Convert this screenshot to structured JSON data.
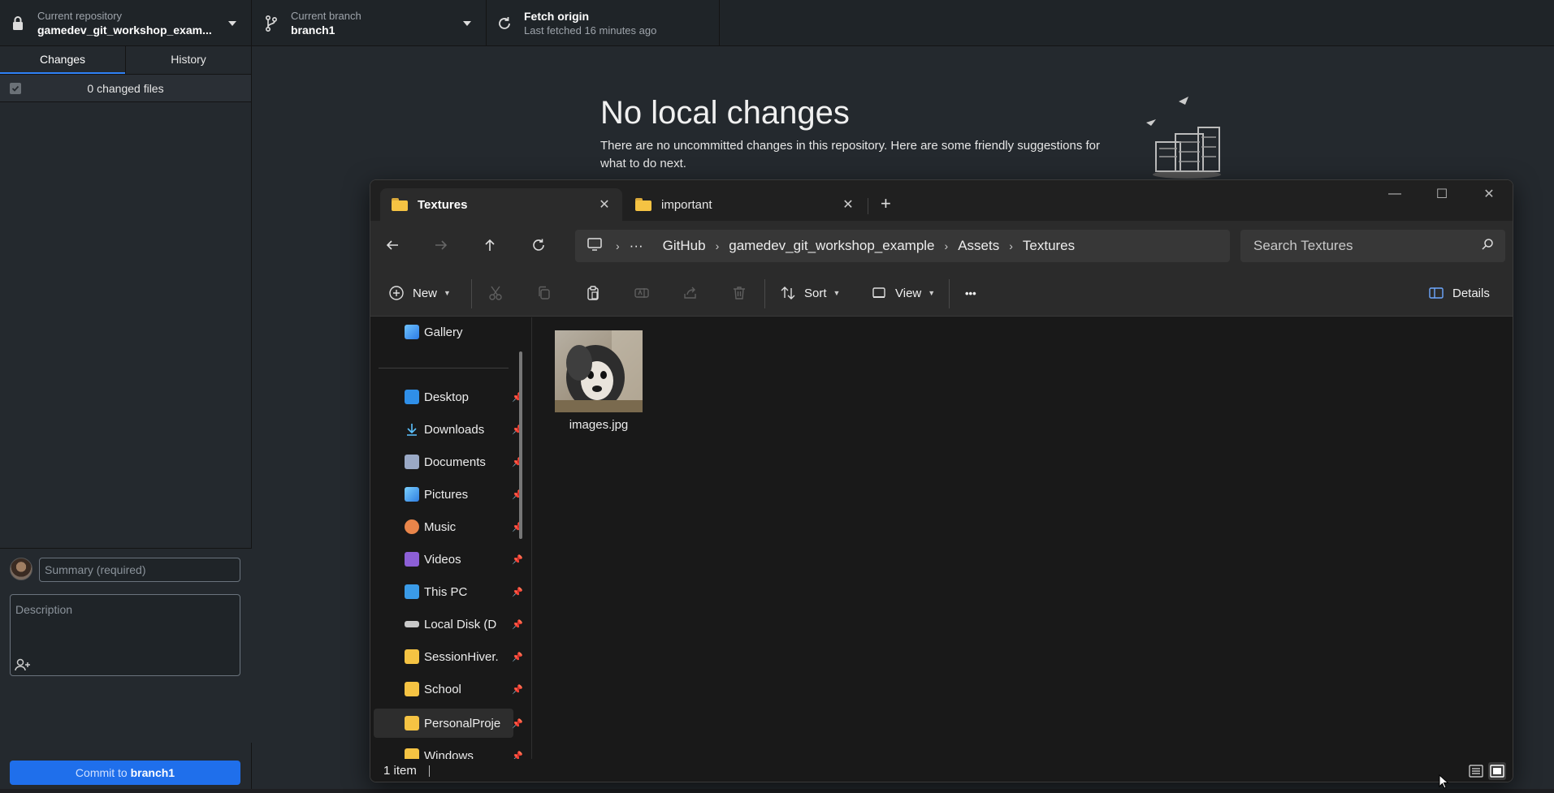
{
  "toolbar": {
    "repo_caption": "Current repository",
    "repo_name": "gamedev_git_workshop_exam...",
    "branch_caption": "Current branch",
    "branch_name": "branch1",
    "fetch_title": "Fetch origin",
    "fetch_subtitle": "Last fetched 16 minutes ago"
  },
  "sidebar": {
    "tabs": [
      {
        "label": "Changes",
        "active": true
      },
      {
        "label": "History",
        "active": false
      }
    ],
    "changed_files": "0 changed files",
    "summary_placeholder": "Summary (required)",
    "description_placeholder": "Description",
    "commit_prefix": "Commit to ",
    "commit_branch": "branch1"
  },
  "main": {
    "title": "No local changes",
    "text": "There are no uncommitted changes in this repository. Here are some friendly suggestions for what to do next."
  },
  "explorer": {
    "tabs": [
      {
        "label": "Textures",
        "active": true
      },
      {
        "label": "important",
        "active": false
      }
    ],
    "breadcrumb": [
      "GitHub",
      "gamedev_git_workshop_example",
      "Assets",
      "Textures"
    ],
    "breadcrumb_overflow": "···",
    "search_placeholder": "Search Textures",
    "commands": {
      "new": "New",
      "sort": "Sort",
      "view": "View",
      "more": "•••",
      "details": "Details"
    },
    "nav_items": [
      {
        "label": "Gallery",
        "icon": "gallery-icon",
        "pinned": false
      },
      {
        "label": "Desktop",
        "icon": "desktop-icon",
        "pinned": true
      },
      {
        "label": "Downloads",
        "icon": "downloads-icon",
        "pinned": true
      },
      {
        "label": "Documents",
        "icon": "documents-icon",
        "pinned": true
      },
      {
        "label": "Pictures",
        "icon": "pictures-icon",
        "pinned": true
      },
      {
        "label": "Music",
        "icon": "music-icon",
        "pinned": true
      },
      {
        "label": "Videos",
        "icon": "videos-icon",
        "pinned": true
      },
      {
        "label": "This PC",
        "icon": "this-pc-icon",
        "pinned": true
      },
      {
        "label": "Local Disk (D",
        "icon": "drive-icon",
        "pinned": true
      },
      {
        "label": "SessionHiver.",
        "icon": "folder-icon",
        "pinned": true
      },
      {
        "label": "School",
        "icon": "folder-icon",
        "pinned": true
      },
      {
        "label": "PersonalProje",
        "icon": "folder-icon",
        "pinned": true
      },
      {
        "label": "Windows",
        "icon": "folder-icon",
        "pinned": true
      }
    ],
    "files": [
      {
        "name": "images.jpg",
        "icon": "image-thumbnail"
      }
    ],
    "status": "1 item"
  },
  "colors": {
    "accent": "#1f6feb",
    "folder": "#f5c343",
    "background": "#24292e"
  }
}
